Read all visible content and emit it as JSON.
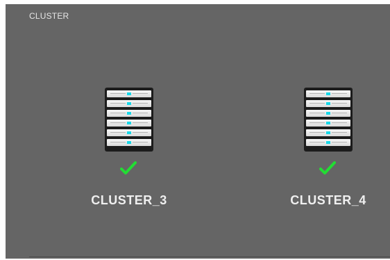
{
  "panel": {
    "title": "CLUSTER"
  },
  "clusters": [
    {
      "label": "CLUSTER_3",
      "icon": "server-rack-icon",
      "status": "ok",
      "status_icon": "green-check-icon"
    },
    {
      "label": "CLUSTER_4",
      "icon": "server-rack-icon",
      "status": "ok",
      "status_icon": "green-check-icon"
    }
  ],
  "colors": {
    "panel_bg": "#656565",
    "led": "#16d7e8",
    "check": "#22dd33",
    "label": "#efefef"
  }
}
